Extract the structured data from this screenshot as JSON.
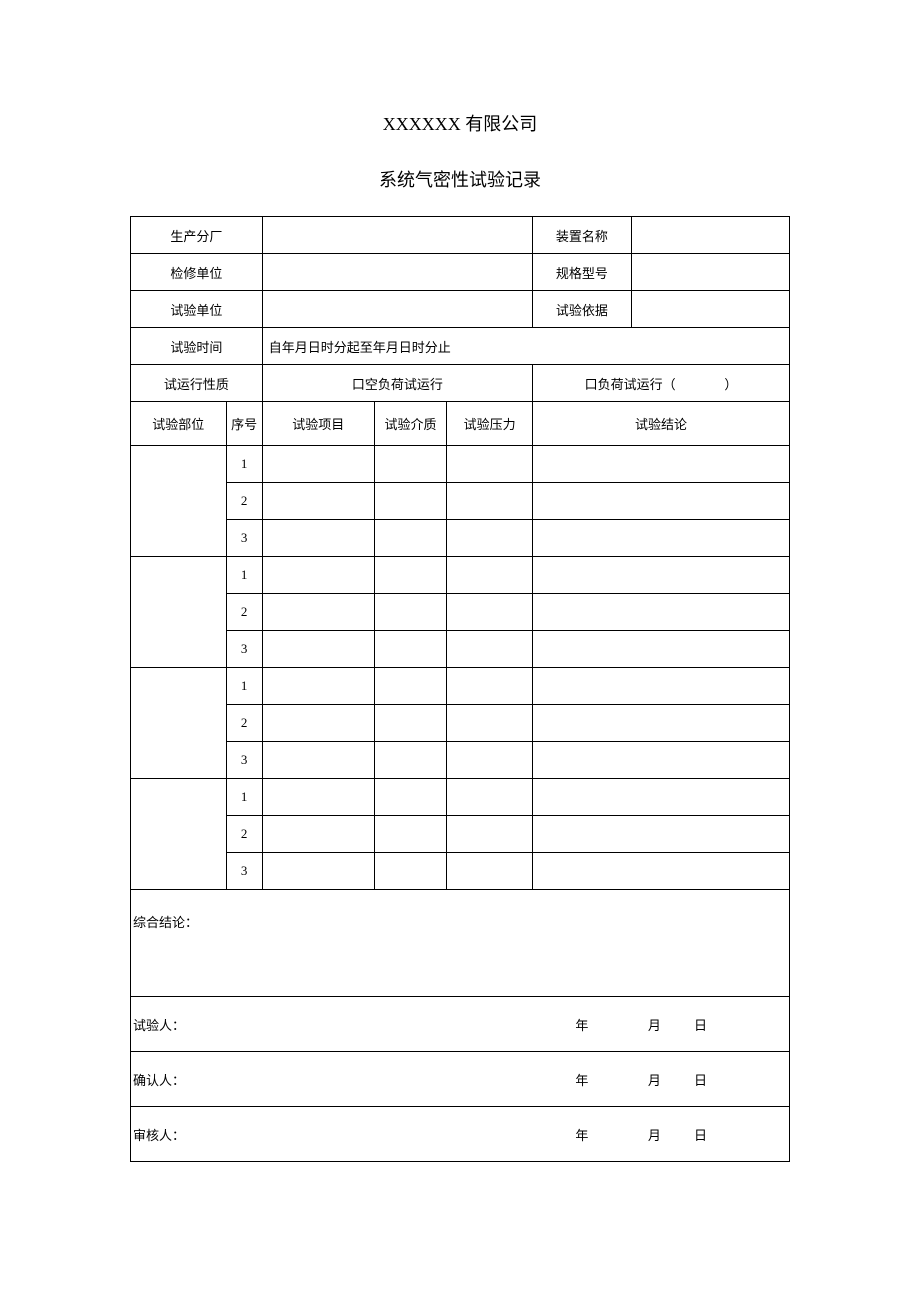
{
  "company": "XXXXXX 有限公司",
  "doc_title": "系统气密性试验记录",
  "labels": {
    "prod_branch": "生产分厂",
    "device_name": "装置名称",
    "maint_unit": "检修单位",
    "spec_model": "规格型号",
    "test_unit": "试验单位",
    "test_basis": "试验依据",
    "test_time": "试验时间",
    "test_time_value": "自年月日时分起至年月日时分止",
    "run_nature": "试运行性质",
    "noload": "口空负荷试运行",
    "load": "口负荷试运行（",
    "load_paren_close": "）",
    "part": "试验部位",
    "seq": "序号",
    "item": "试验项目",
    "medium": "试验介质",
    "pressure": "试验压力",
    "conclusion": "试验结论",
    "overall": "综合结论：",
    "tester": "试验人：",
    "confirmer": "确认人：",
    "reviewer": "审核人：",
    "year": "年",
    "month": "月",
    "day": "日"
  },
  "seq_nums": [
    "1",
    "2",
    "3"
  ]
}
